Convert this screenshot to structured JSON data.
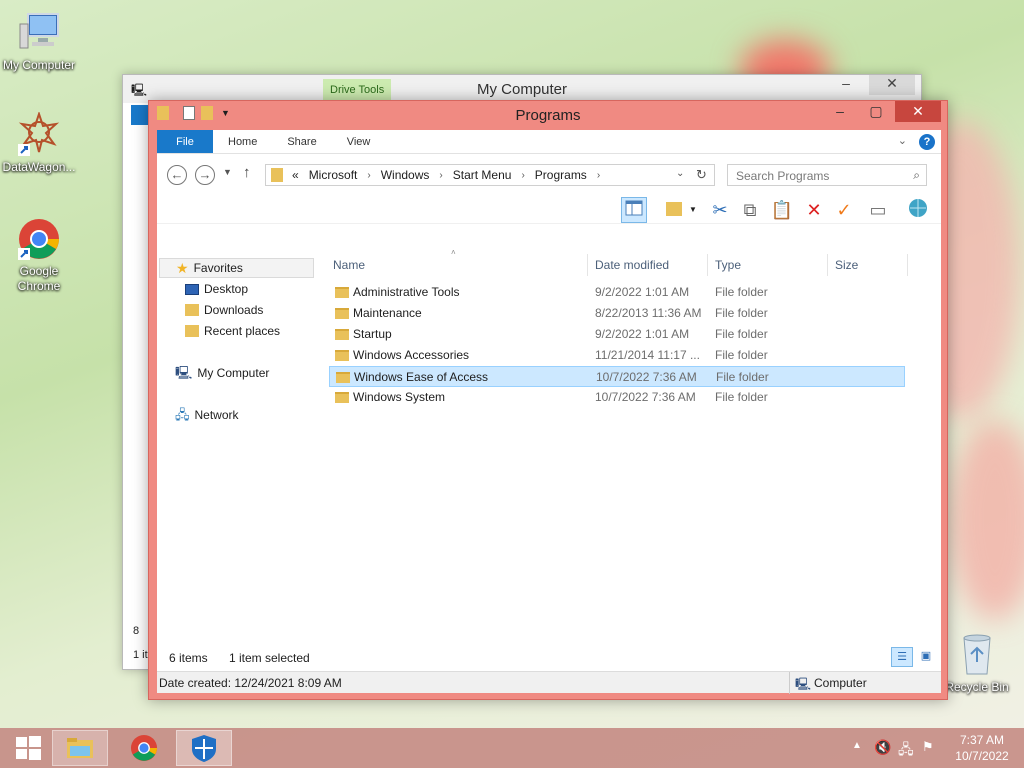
{
  "desktop": {
    "icons": [
      {
        "label": "My Computer"
      },
      {
        "label": "DataWagon..."
      },
      {
        "label": "Google Chrome"
      },
      {
        "label": "Recycle Bin"
      }
    ]
  },
  "back_window": {
    "title": "My Computer",
    "context_tab": "Drive Tools",
    "status_count": "1 it",
    "side_fragment": "8"
  },
  "window": {
    "title": "Programs",
    "ribbon": {
      "tabs": [
        "File",
        "Home",
        "Share",
        "View"
      ]
    },
    "breadcrumb": {
      "prefix": "«",
      "crumbs": [
        "Microsoft",
        "Windows",
        "Start Menu",
        "Programs"
      ]
    },
    "search_placeholder": "Search Programs",
    "nav": {
      "favorites": "Favorites",
      "favorite_items": [
        "Desktop",
        "Downloads",
        "Recent places"
      ],
      "computer": "My Computer",
      "network": "Network"
    },
    "columns": [
      "Name",
      "Date modified",
      "Type",
      "Size"
    ],
    "files": [
      {
        "name": "Administrative Tools",
        "date": "9/2/2022 1:01 AM",
        "type": "File folder",
        "selected": false
      },
      {
        "name": "Maintenance",
        "date": "8/22/2013 11:36 AM",
        "type": "File folder",
        "selected": false
      },
      {
        "name": "Startup",
        "date": "9/2/2022 1:01 AM",
        "type": "File folder",
        "selected": false
      },
      {
        "name": "Windows Accessories",
        "date": "11/21/2014 11:17 ...",
        "type": "File folder",
        "selected": false
      },
      {
        "name": "Windows Ease of Access",
        "date": "10/7/2022 7:36 AM",
        "type": "File folder",
        "selected": true
      },
      {
        "name": "Windows System",
        "date": "10/7/2022 7:36 AM",
        "type": "File folder",
        "selected": false
      }
    ],
    "status": {
      "count": "6 items",
      "selection": "1 item selected"
    },
    "details": {
      "created": "Date created: 12/24/2021 8:09 AM",
      "location": "Computer"
    }
  },
  "taskbar": {
    "clock_time": "7:37 AM",
    "clock_date": "10/7/2022"
  },
  "colors": {
    "accent": "#1979ca",
    "window_frame": "#f08a82",
    "selection": "#cce8ff"
  }
}
